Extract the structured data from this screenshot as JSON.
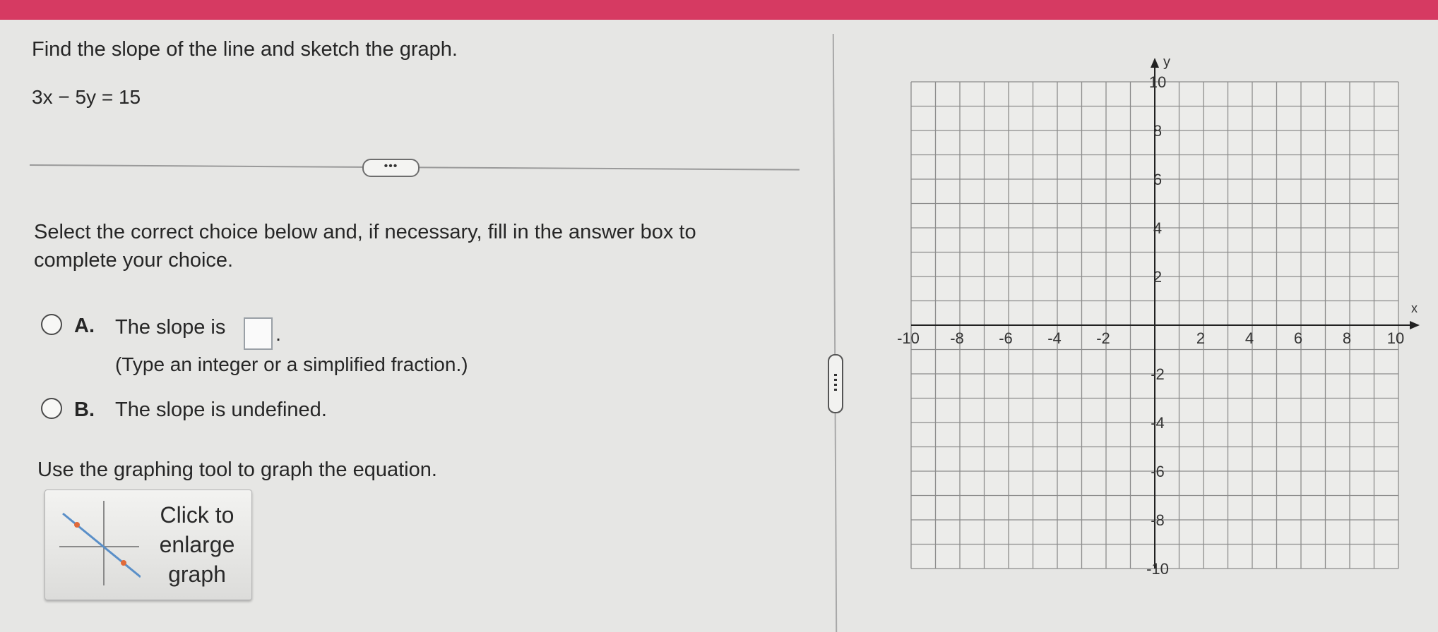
{
  "question": {
    "title": "Find the slope of the line and sketch the graph.",
    "equation": "3x − 5y = 15"
  },
  "more_button_label": "•••",
  "instruction": "Select the correct choice below and, if necessary, fill in the answer box to complete your choice.",
  "choices": [
    {
      "letter": "A.",
      "text": "The slope is",
      "hint": "(Type an integer or a simplified fraction.)",
      "answer_value": ""
    },
    {
      "letter": "B.",
      "text": "The slope is undefined."
    }
  ],
  "graph_instruction": "Use the graphing tool to graph the equation.",
  "enlarge_button": {
    "line1": "Click to",
    "line2": "enlarge",
    "line3": "graph"
  },
  "graph": {
    "x_label": "x",
    "y_label": "y",
    "x_range": [
      -10,
      10
    ],
    "y_range": [
      -10,
      10
    ],
    "grid_step": 1,
    "x_tick_labels": [
      "-10",
      "-8",
      "-6",
      "-4",
      "-2",
      "2",
      "4",
      "6",
      "8",
      "10"
    ],
    "y_tick_labels": [
      "10",
      "8",
      "6",
      "4",
      "2",
      "-2",
      "-4",
      "-6",
      "-8",
      "-10"
    ]
  },
  "colors": {
    "top_bar": "#d63a62",
    "grid_line": "#8c8c8c",
    "axis": "#222222"
  }
}
